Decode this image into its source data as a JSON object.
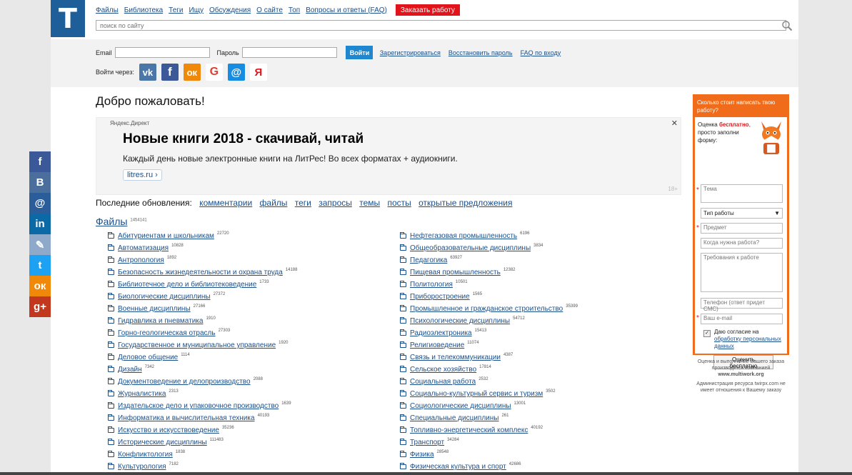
{
  "logo": "T",
  "nav": [
    "Файлы",
    "Библиотека",
    "Теги",
    "Ищу",
    "Обсуждения",
    "О сайте",
    "Топ",
    "Вопросы и ответы (FAQ)"
  ],
  "order_button": "Заказать работу",
  "search": {
    "placeholder": "поиск по сайту"
  },
  "login": {
    "email_label": "Email",
    "password_label": "Пароль",
    "login_button": "Войти",
    "register": "Зарегистрироваться",
    "restore": "Восстановить пароль",
    "faq": "FAQ по входу",
    "via_label": "Войти через:",
    "via_icons": [
      "vk-icon",
      "facebook-icon",
      "odnoklassniki-icon",
      "google-icon",
      "mailru-icon",
      "yandex-icon"
    ]
  },
  "welcome": "Добро пожаловать!",
  "ad": {
    "label": "Яндекс.Директ",
    "title": "Новые книги 2018 - скачивай, читай",
    "text": "Каждый день новые электронные книги на ЛитРес! Во всех форматах + аудиокниги.",
    "link": "litres.ru ›",
    "age": "18+"
  },
  "updates": {
    "label": "Последние обновления:",
    "links": [
      "комментарии",
      "файлы",
      "теги",
      "запросы",
      "темы",
      "посты",
      "открытые предложения"
    ]
  },
  "files": {
    "title": "Файлы",
    "count": "1454141"
  },
  "categories_left": [
    {
      "name": "Абитуриентам и школьникам",
      "count": "22720"
    },
    {
      "name": "Автоматизация",
      "count": "10828"
    },
    {
      "name": "Антропология",
      "count": "1892"
    },
    {
      "name": "Безопасность жизнедеятельности и охрана труда",
      "count": "14188"
    },
    {
      "name": "Библиотечное дело и библиотековедение",
      "count": "1733"
    },
    {
      "name": "Биологические дисциплины",
      "count": "27372"
    },
    {
      "name": "Военные дисциплины",
      "count": "27166"
    },
    {
      "name": "Гидравлика и пневматика",
      "count": "1910"
    },
    {
      "name": "Горно-геологическая отрасль",
      "count": "27303"
    },
    {
      "name": "Государственное и муниципальное управление",
      "count": "1920"
    },
    {
      "name": "Деловое общение",
      "count": "1114"
    },
    {
      "name": "Дизайн",
      "count": "7342"
    },
    {
      "name": "Документоведение и делопроизводство",
      "count": "2088"
    },
    {
      "name": "Журналистика",
      "count": "2313"
    },
    {
      "name": "Издательское дело и упаковочное производство",
      "count": "1639"
    },
    {
      "name": "Информатика и вычислительная техника",
      "count": "40193"
    },
    {
      "name": "Искусство и искусствоведение",
      "count": "35236"
    },
    {
      "name": "Исторические дисциплины",
      "count": "111483"
    },
    {
      "name": "Конфликтология",
      "count": "1838"
    },
    {
      "name": "Культурология",
      "count": "7182"
    }
  ],
  "categories_right": [
    {
      "name": "Нефтегазовая промышленность",
      "count": "6196"
    },
    {
      "name": "Общеобразовательные дисциплины",
      "count": "3834"
    },
    {
      "name": "Педагогика",
      "count": "63927"
    },
    {
      "name": "Пищевая промышленность",
      "count": "12382"
    },
    {
      "name": "Политология",
      "count": "10501"
    },
    {
      "name": "Приборостроение",
      "count": "1565"
    },
    {
      "name": "Промышленное и гражданское строительство",
      "count": "35399"
    },
    {
      "name": "Психологические дисциплины",
      "count": "54712"
    },
    {
      "name": "Радиоэлектроника",
      "count": "15413"
    },
    {
      "name": "Религиоведение",
      "count": "11074"
    },
    {
      "name": "Связь и телекоммуникации",
      "count": "4387"
    },
    {
      "name": "Сельское хозяйство",
      "count": "17814"
    },
    {
      "name": "Социальная работа",
      "count": "2532"
    },
    {
      "name": "Социально-культурный сервис и туризм",
      "count": "3502"
    },
    {
      "name": "Социологические дисциплины",
      "count": "13001"
    },
    {
      "name": "Специальные дисциплины",
      "count": "261"
    },
    {
      "name": "Топливно-энергетический комплекс",
      "count": "40192"
    },
    {
      "name": "Транспорт",
      "count": "34284"
    },
    {
      "name": "Физика",
      "count": "28548"
    },
    {
      "name": "Физическая культура и спорт",
      "count": "42686"
    }
  ],
  "order_form": {
    "header": "Сколько стоит написать твою работу?",
    "promo_1": "Оценка",
    "promo_bold": "бесплатно",
    "promo_2": ", просто заполни форму:",
    "topic": "Тема",
    "work_type": "Тип работы",
    "subject": "Предмет",
    "deadline": "Когда нужна работа?",
    "requirements": "Требования к работе",
    "phone": "Телефон (ответ придет СМС)",
    "email": "Ваш e-mail",
    "consent_prefix": "Даю согласие на",
    "consent_link": "обработку персональных данных",
    "submit": "Оценить бесплатно",
    "note_1": "Оценка и выполнение Вашего заказа производится компанией",
    "note_company": "www.multiwork.org",
    "note_2": "Администрация ресурса twirpx.com не имеет отношения к Вашему заказу"
  },
  "share": [
    {
      "icon": "facebook-icon",
      "glyph": "f",
      "color": "#3b5998"
    },
    {
      "icon": "vk-icon",
      "glyph": "В",
      "color": "#4a6f9d"
    },
    {
      "icon": "mailru-icon",
      "glyph": "@",
      "color": "#2a5d9a"
    },
    {
      "icon": "linkedin-icon",
      "glyph": "in",
      "color": "#0b6aa6"
    },
    {
      "icon": "livejournal-icon",
      "glyph": "✎",
      "color": "#8ea9c9"
    },
    {
      "icon": "twitter-icon",
      "glyph": "t",
      "color": "#1da1f2"
    },
    {
      "icon": "odnoklassniki-icon",
      "glyph": "ок",
      "color": "#f0880a"
    },
    {
      "icon": "googleplus-icon",
      "glyph": "g+",
      "color": "#c2381f"
    }
  ]
}
